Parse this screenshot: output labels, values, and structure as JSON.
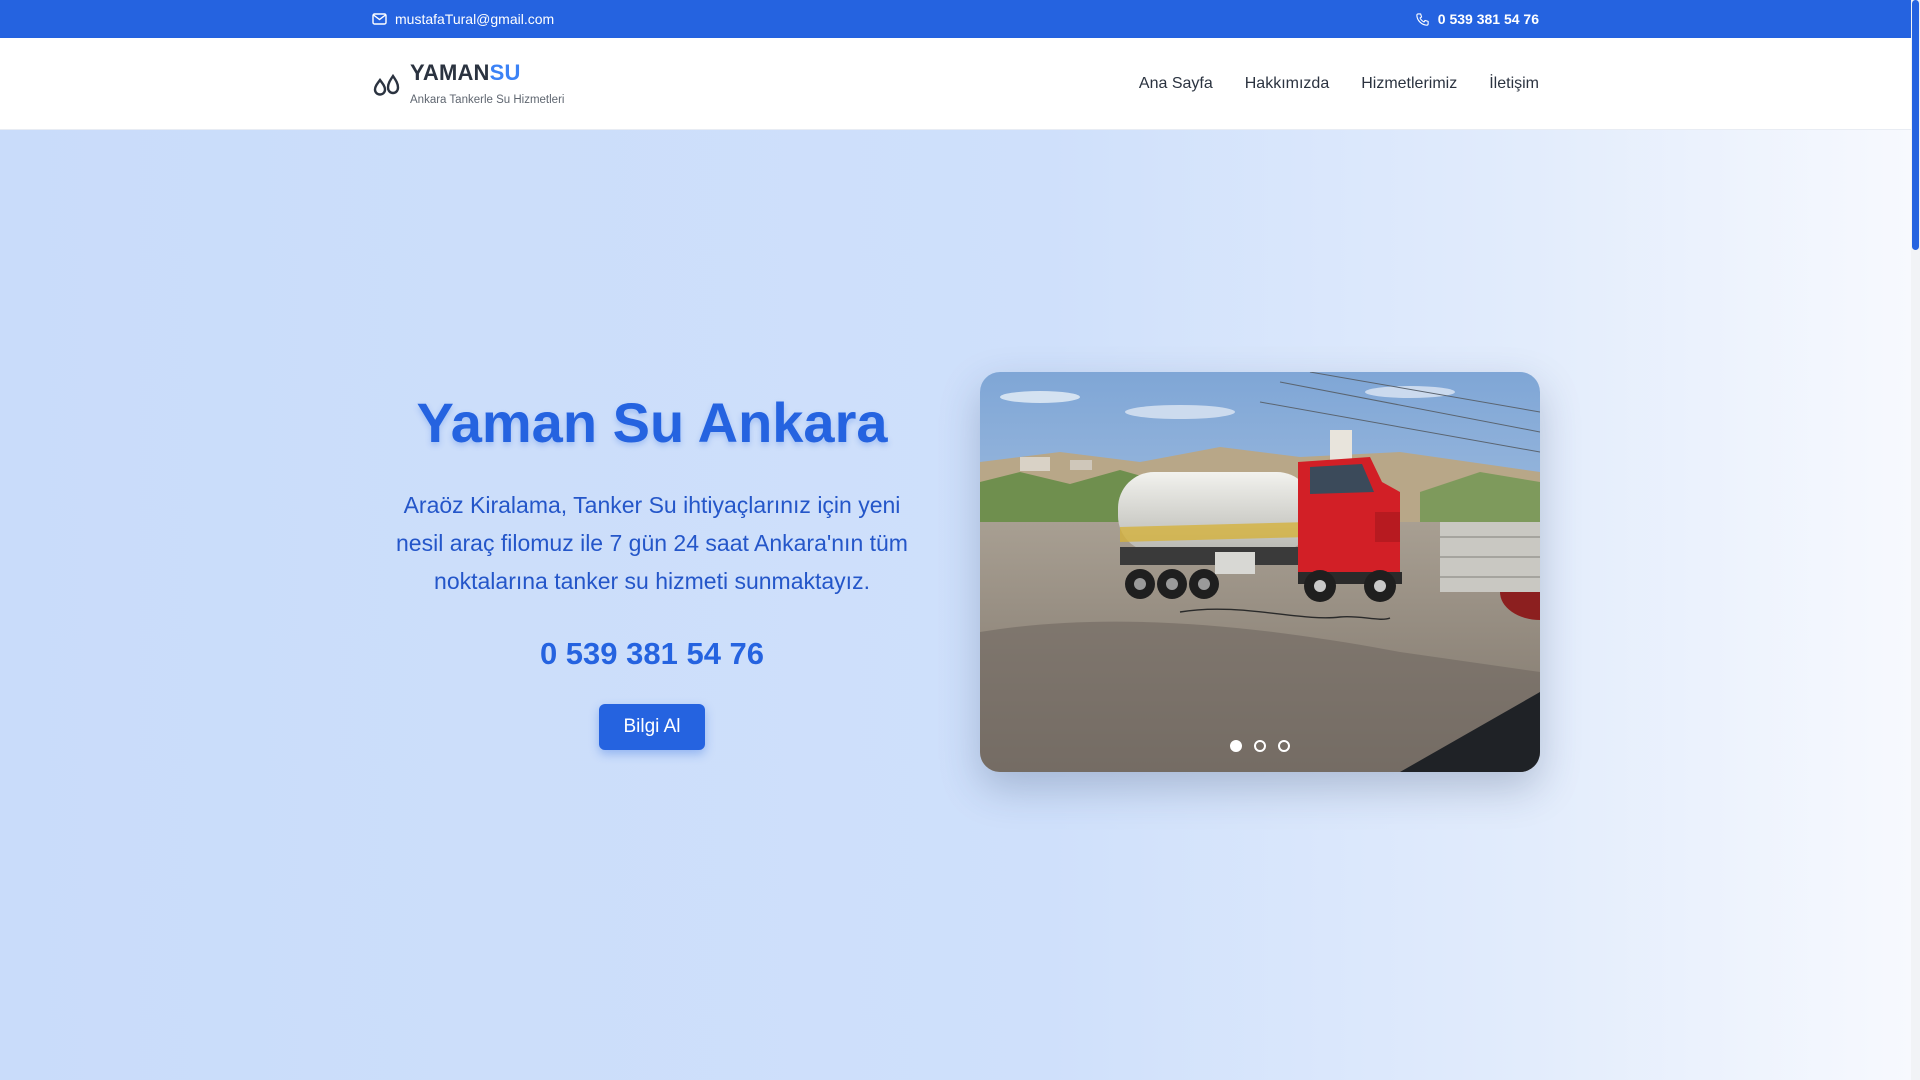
{
  "topbar": {
    "email": "mustafaTural@gmail.com",
    "phone": "0 539 381 54 76",
    "email_icon": "mail-icon",
    "phone_icon": "phone-icon"
  },
  "brand": {
    "name_part1": "YAMAN",
    "name_part2": "SU",
    "tagline": "Ankara Tankerle Su Hizmetleri",
    "logo_icon": "water-drops-icon"
  },
  "nav": {
    "items": [
      {
        "label": "Ana Sayfa"
      },
      {
        "label": "Hakkımızda"
      },
      {
        "label": "Hizmetlerimiz"
      },
      {
        "label": "İletişim"
      }
    ]
  },
  "hero": {
    "title": "Yaman Su Ankara",
    "description": "Araöz Kiralama, Tanker Su ihtiyaçlarınız için yeni nesil araç filomuz ile 7 gün 24 saat Ankara'nın tüm noktalarına tanker su hizmeti sunmaktayız.",
    "phone": "0 539 381 54 76",
    "button_label": "Bilgi Al"
  },
  "slider": {
    "slide_count": 3,
    "active_slide": 1,
    "image_subject": "red water tanker truck"
  },
  "colors": {
    "primary": "#2563e0",
    "accent": "#3b82f6",
    "text_dark": "#2b3340"
  }
}
